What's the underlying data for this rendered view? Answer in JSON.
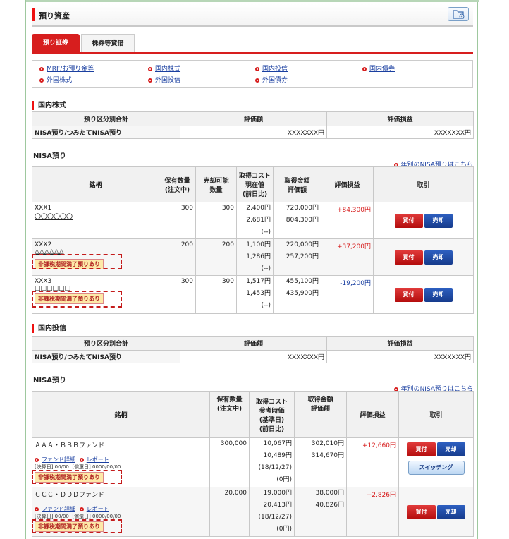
{
  "header": {
    "title": "預り資産"
  },
  "tabs": [
    "預り証券",
    "株券等貸借"
  ],
  "links": [
    {
      "label": "MRF/お預り金等"
    },
    {
      "label": "国内株式"
    },
    {
      "label": "国内投信"
    },
    {
      "label": "国内債券"
    },
    {
      "label": "外国株式"
    },
    {
      "label": "外国投信"
    },
    {
      "label": "外国債券"
    }
  ],
  "domestic_stock": {
    "section": "国内株式",
    "summary_headers": [
      "預り区分別合計",
      "評価額",
      "評価損益"
    ],
    "summary_row": {
      "label": "NISA預り/つみたてNISA預り",
      "value": "XXXXXXX円",
      "pl": "XXXXXXX円"
    },
    "nisa_title": "NISA預り",
    "nisa_link": "年別のNISA預りはこちら",
    "headers": {
      "name": "銘柄",
      "held": "保有数量",
      "held2": "(注文中)",
      "sellable": "売却可能",
      "sellable2": "数量",
      "cost": "取得コスト",
      "cost2": "現在値",
      "cost3": "(前日比)",
      "amount": "取得金額",
      "amount2": "評価額",
      "pl": "評価損益",
      "trade": "取引"
    },
    "rows": [
      {
        "code": "XXX1",
        "name": "〇〇〇〇〇〇",
        "held": "300",
        "sellable": "300",
        "cost": "2,400円",
        "price": "2,681円",
        "change": "(--)",
        "acq": "720,000円",
        "eval": "804,300円",
        "pl": "+84,300円",
        "badge": ""
      },
      {
        "code": "XXX2",
        "name": "△△△△△△",
        "held": "200",
        "sellable": "200",
        "cost": "1,100円",
        "price": "1,286円",
        "change": "(--)",
        "acq": "220,000円",
        "eval": "257,200円",
        "pl": "+37,200円",
        "badge": "非課税期間満了預りあり"
      },
      {
        "code": "XXX3",
        "name": "□□□□□□",
        "held": "300",
        "sellable": "300",
        "cost": "1,517円",
        "price": "1,453円",
        "change": "(--)",
        "acq": "455,100円",
        "eval": "435,900円",
        "pl": "-19,200円",
        "badge": "非課税期間満了預りあり"
      }
    ]
  },
  "domestic_fund": {
    "section": "国内投信",
    "summary_headers": [
      "預り区分別合計",
      "評価額",
      "評価損益"
    ],
    "summary_row": {
      "label": "NISA預り/つみたてNISA預り",
      "value": "XXXXXXX円",
      "pl": "XXXXXXX円"
    },
    "nisa_title": "NISA預り",
    "nisa_link": "年別のNISA預りはこちら",
    "headers": {
      "name": "銘柄",
      "held": "保有数量",
      "held2": "(注文中)",
      "cost": "取得コスト",
      "cost2": "参考時価",
      "cost3": "(基準日)",
      "cost4": "(前日比)",
      "amount": "取得金額",
      "amount2": "評価額",
      "pl": "評価損益",
      "trade": "取引"
    },
    "rows": [
      {
        "name": "ＡＡＡ・ＢＢＢファンド",
        "detail": "ファンド詳細",
        "report": "レポート",
        "settle": "[決算日] 00/00",
        "ref": "[償還日] 0000/00/00",
        "held": "300,000",
        "cost": "10,067円",
        "price": "10,489円",
        "date": "(18/12/27)",
        "change": "(0円)",
        "acq": "302,010円",
        "eval": "314,670円",
        "pl": "+12,660円",
        "badge": "非課税期間満了預りあり",
        "switch": "スイッチング"
      },
      {
        "name": "ＣＣＣ・ＤＤＤファンド",
        "detail": "ファンド詳細",
        "report": "レポート",
        "settle": "[決算日] 00/00",
        "ref": "[償還日] 0000/00/00",
        "held": "20,000",
        "cost": "19,000円",
        "price": "20,413円",
        "date": "(18/12/27)",
        "change": "(0円)",
        "acq": "38,000円",
        "eval": "40,826円",
        "pl": "+2,826円",
        "badge": "非課税期間満了預りあり",
        "switch": ""
      }
    ]
  },
  "buttons": {
    "buy": "買付",
    "sell": "売却"
  },
  "colors": {
    "accent": "#d71e1e",
    "link": "#1a3fa0",
    "sell": "#163b8c"
  }
}
